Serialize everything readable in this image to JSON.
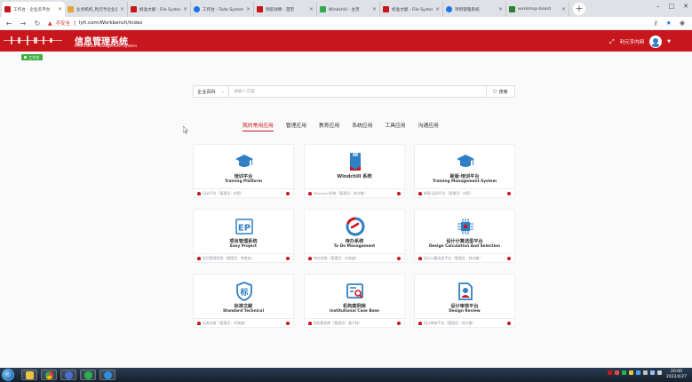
{
  "browser": {
    "tabs": [
      {
        "label": "工作台 - 企业云平台",
        "color": "#c8161d",
        "active": true
      },
      {
        "label": "业务机构_利元亨企业云平台",
        "color": "#e6a23c",
        "active": false
      },
      {
        "label": "标准文献 - File System",
        "color": "#c8161d",
        "active": false
      },
      {
        "label": "工作台 - Todo System",
        "color": "#1a73e8",
        "active": false
      },
      {
        "label": "领航详情 - 首页",
        "color": "#c8161d",
        "active": false
      },
      {
        "label": "Windchill - 主页",
        "color": "#34a853",
        "active": false
      },
      {
        "label": "标准文献 - File System",
        "color": "#c8161d",
        "active": false
      },
      {
        "label": "项目管理系统",
        "color": "#1a73e8",
        "active": false
      },
      {
        "label": "workshop-board",
        "color": "#2e7d32",
        "active": false
      }
    ],
    "insecure_label": "不安全",
    "url": "lyh.com/Workbench/Index",
    "new_tab": "+"
  },
  "header": {
    "system_name": "信息管理系统",
    "system_name_en": "Information Management System",
    "user_name": "利元亨内网"
  },
  "breadcrumb": {
    "label": "工作台"
  },
  "search": {
    "scope": "企业百科",
    "placeholder": "请输入内容",
    "button": "搜索"
  },
  "categories": [
    {
      "label": "我的常用应用",
      "active": true
    },
    {
      "label": "管理应用",
      "active": false
    },
    {
      "label": "教育应用",
      "active": false
    },
    {
      "label": "系统应用",
      "active": false
    },
    {
      "label": "工具应用",
      "active": false
    },
    {
      "label": "沟通应用",
      "active": false
    }
  ],
  "apps": [
    {
      "title": "培训平台",
      "subtitle": "Training Platform",
      "footer": "培训平台（管理员：刘雨）",
      "icon": "graduation-cap-icon"
    },
    {
      "title": "Windchill 系统",
      "subtitle": "",
      "footer": "Windchill系统（管理员：林方敏）",
      "icon": "bookmark-icon"
    },
    {
      "title": "新版·培训平台",
      "subtitle": "Training Management System",
      "footer": "新版·培训平台（管理员：刘雨）",
      "icon": "graduation-cap-icon"
    },
    {
      "title": "项目管理系统",
      "subtitle": "Easy Project",
      "footer": "项目管理系统（管理员：李振宏）",
      "icon": "ep-logo-icon"
    },
    {
      "title": "待办系统",
      "subtitle": "To Do Management",
      "footer": "待办系统（管理员：刘海波）",
      "icon": "todo-ring-icon"
    },
    {
      "title": "设计计算选型平台",
      "subtitle": "Design Calculation And Selection",
      "footer": "设计计算选型平台（管理员：林方敏）",
      "icon": "chip-icon"
    },
    {
      "title": "标准文献",
      "subtitle": "Standard Technical",
      "footer": "标准文献（管理员：刘海波）",
      "icon": "shield-standard-icon"
    },
    {
      "title": "机构案例库",
      "subtitle": "Institutional Case Base",
      "footer": "机构案例库（管理员：潘子林）",
      "icon": "case-search-icon"
    },
    {
      "title": "设计审核平台",
      "subtitle": "Design Review",
      "footer": "设计审核平台（管理员：林方敏）",
      "icon": "review-doc-icon"
    }
  ],
  "colors": {
    "brand": "#c8161d",
    "blue": "#2f7fc5",
    "green": "#3fae44"
  },
  "taskbar": {
    "time": "20:00",
    "date": "2022/4/27"
  }
}
